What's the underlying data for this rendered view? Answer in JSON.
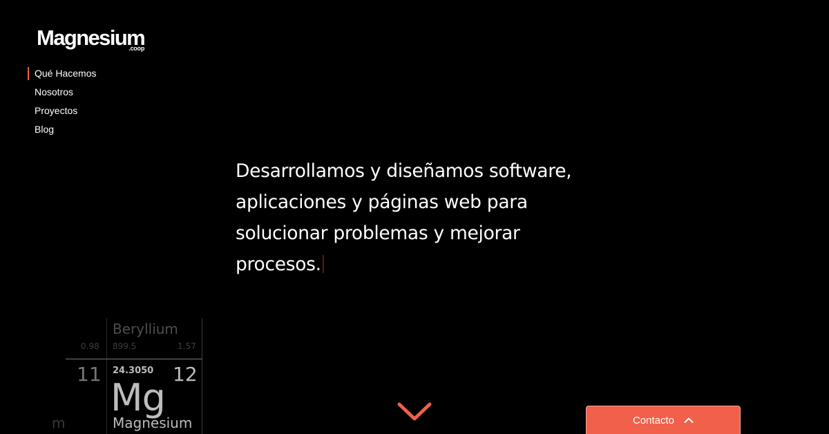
{
  "brand": {
    "name": "Magnesium",
    "suffix": ".coop"
  },
  "nav": {
    "items": [
      {
        "label": "Qué Hacemos",
        "active": true
      },
      {
        "label": "Nosotros",
        "active": false
      },
      {
        "label": "Proyectos",
        "active": false
      },
      {
        "label": "Blog",
        "active": false
      }
    ]
  },
  "hero": {
    "lines": [
      "Desarrollamos y diseñamos software,",
      "aplicaciones y páginas web para",
      "solucionar problemas y mejorar",
      "procesos."
    ]
  },
  "periodic_table": {
    "beryllium": {
      "name": "Beryllium",
      "melting": "899.5",
      "electronegativity": "1.57"
    },
    "sodium_fragment": {
      "electronegativity": "0.98",
      "atomic_number": "11",
      "name_fragment": "m"
    },
    "magnesium": {
      "atomic_mass": "24.3050",
      "atomic_number": "12",
      "symbol": "Mg",
      "name": "Magnesium"
    }
  },
  "scroll": {
    "icon": "chevron-down-icon"
  },
  "contact": {
    "label": "Contacto",
    "icon": "chevron-up-icon"
  },
  "colors": {
    "accent": "#f0604a",
    "background": "#000000"
  }
}
